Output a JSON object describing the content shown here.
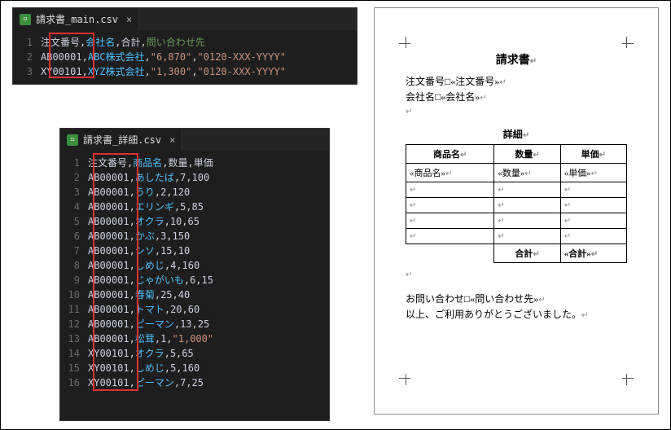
{
  "editor_top": {
    "filename": "請求書_main.csv",
    "rows": [
      {
        "n": "1",
        "c0": "注文番号",
        "c1": "会社名",
        "c2": "合計",
        "c3": "問い合わせ先",
        "quoted": false
      },
      {
        "n": "2",
        "c0": "AB00001",
        "c1": "ABC株式会社",
        "c2": "\"6,870\"",
        "c3": "\"0120-XXX-YYYY\"",
        "quoted": true
      },
      {
        "n": "3",
        "c0": "XY00101",
        "c1": "XYZ株式会社",
        "c2": "\"1,300\"",
        "c3": "\"0120-XXX-YYYY\"",
        "quoted": true
      }
    ]
  },
  "editor_bottom": {
    "filename": "請求書_詳細.csv",
    "rows": [
      {
        "n": "1",
        "c0": "注文番号",
        "c1": "商品名",
        "c2": "数量",
        "c3": "単価"
      },
      {
        "n": "2",
        "c0": "AB00001",
        "c1": "あしたば",
        "c2": "7",
        "c3": "100"
      },
      {
        "n": "3",
        "c0": "AB00001",
        "c1": "うり",
        "c2": "2",
        "c3": "120"
      },
      {
        "n": "4",
        "c0": "AB00001",
        "c1": "エリンギ",
        "c2": "5",
        "c3": "85"
      },
      {
        "n": "5",
        "c0": "AB00001",
        "c1": "オクラ",
        "c2": "10",
        "c3": "65"
      },
      {
        "n": "6",
        "c0": "AB00001",
        "c1": "かぶ",
        "c2": "3",
        "c3": "150"
      },
      {
        "n": "7",
        "c0": "AB00001",
        "c1": "シソ",
        "c2": "15",
        "c3": "10"
      },
      {
        "n": "8",
        "c0": "AB00001",
        "c1": "しめじ",
        "c2": "4",
        "c3": "160"
      },
      {
        "n": "9",
        "c0": "AB00001",
        "c1": "じゃがいも",
        "c2": "6",
        "c3": "15"
      },
      {
        "n": "10",
        "c0": "AB00001",
        "c1": "春菊",
        "c2": "25",
        "c3": "40"
      },
      {
        "n": "11",
        "c0": "AB00001",
        "c1": "トマト",
        "c2": "20",
        "c3": "60"
      },
      {
        "n": "12",
        "c0": "AB00001",
        "c1": "ピーマン",
        "c2": "13",
        "c3": "25"
      },
      {
        "n": "13",
        "c0": "AB00001",
        "c1": "松茸",
        "c2": "1",
        "c3": "\"1,000\""
      },
      {
        "n": "14",
        "c0": "XY00101",
        "c1": "オクラ",
        "c2": "5",
        "c3": "65"
      },
      {
        "n": "15",
        "c0": "XY00101",
        "c1": "しめじ",
        "c2": "5",
        "c3": "160"
      },
      {
        "n": "16",
        "c0": "XY00101",
        "c1": "ピーマン",
        "c2": "7",
        "c3": "25"
      }
    ]
  },
  "doc": {
    "title": "請求書",
    "order_label": "注文番号□",
    "order_field": "«注文番号»",
    "company_label": "会社名□",
    "company_field": "«会社名»",
    "detail_heading": "詳細",
    "th_name": "商品名",
    "th_qty": "数量",
    "th_price": "単価",
    "field_name": "«商品名»",
    "field_qty": "«数量»",
    "field_price": "«単価»",
    "total_label": "合計",
    "total_field": "«合計»",
    "contact_label": "お問い合わせ□",
    "contact_field": "«問い合わせ先»",
    "thanks": "以上、ご利用ありがとうございました。"
  },
  "glyphs": {
    "ret": "↵",
    "dot": "・"
  }
}
